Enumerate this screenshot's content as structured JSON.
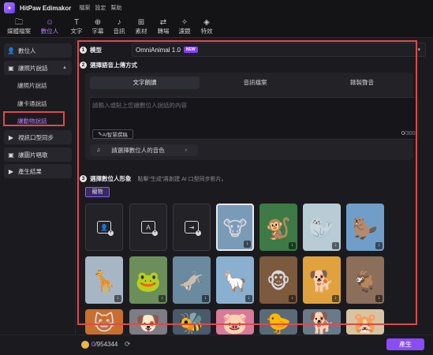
{
  "titlebar": {
    "app_name": "HitPaw Edimakor",
    "menus": [
      "檔案",
      "設定",
      "幫助"
    ]
  },
  "toolbar": {
    "tools": [
      {
        "label": "媒體檔案",
        "icon": "folder-icon"
      },
      {
        "label": "數位人",
        "icon": "digital-human-icon"
      },
      {
        "label": "文字",
        "icon": "text-icon"
      },
      {
        "label": "字幕",
        "icon": "subtitle-icon"
      },
      {
        "label": "音訊",
        "icon": "music-icon"
      },
      {
        "label": "素材",
        "icon": "assets-icon"
      },
      {
        "label": "轉場",
        "icon": "transition-icon"
      },
      {
        "label": "濾鏡",
        "icon": "filter-icon"
      },
      {
        "label": "特效",
        "icon": "effects-icon"
      }
    ],
    "active": "數位人"
  },
  "sidebar": {
    "items": [
      {
        "label": "數位人"
      },
      {
        "label": "讓照片說話"
      },
      {
        "label": "視訊口型同步"
      },
      {
        "label": "讓圖片唱歌"
      },
      {
        "label": "產生結果"
      }
    ],
    "sub_items": [
      "讓照片說話",
      "讓卡通說話",
      "讓動物說話"
    ],
    "selected_sub": "讓動物說話"
  },
  "model": {
    "step": "1",
    "label": "模型",
    "value": "OmniAnimal 1.0",
    "badge": "NEW"
  },
  "upload": {
    "step": "2",
    "label": "選擇語音上傳方式",
    "tabs": [
      "文字朗讀",
      "音訊檔案",
      "錄製聲音"
    ],
    "active_tab": "文字朗讀",
    "placeholder": "請輸入或貼上您讓數位人說話的內容",
    "ai_button": "AI智慧撰稿",
    "counter_current": "0",
    "counter_max": "/300",
    "voice_button": "請選擇數位人的音色"
  },
  "avatar": {
    "step": "3",
    "label": "選擇數位人形象",
    "hint": "點擊“生成”將創建 AI 口型同步影片。",
    "category": "寵物",
    "tiles": [
      {
        "kind": "action",
        "icon": "upload-avatar-icon"
      },
      {
        "kind": "action",
        "icon": "ai-generate-icon"
      },
      {
        "kind": "action",
        "icon": "import-icon"
      },
      {
        "kind": "animal",
        "icon": "highland-cow-icon",
        "glyph": "🐮",
        "bg": "#7a9bb8"
      },
      {
        "kind": "animal",
        "icon": "chimp-icon",
        "glyph": "🐒",
        "bg": "#3d7a45"
      },
      {
        "kind": "animal",
        "icon": "seal-icon",
        "glyph": "🦭",
        "bg": "#b8ccd6"
      },
      {
        "kind": "animal",
        "icon": "capybara-icon",
        "glyph": "🦫",
        "bg": "#6f9fc9"
      },
      {
        "kind": "animal",
        "icon": "giraffe-icon",
        "glyph": "🦒",
        "bg": "#a7b6c4"
      },
      {
        "kind": "animal",
        "icon": "frog-icon",
        "glyph": "🐸",
        "bg": "#6b8e5a"
      },
      {
        "kind": "animal",
        "icon": "donkey-icon",
        "glyph": "🫏",
        "bg": "#6a8aa0"
      },
      {
        "kind": "animal",
        "icon": "llama-icon",
        "glyph": "🦙",
        "bg": "#8ab0cf"
      },
      {
        "kind": "animal",
        "icon": "monkey-icon",
        "glyph": "🐵",
        "bg": "#7c5a3e"
      },
      {
        "kind": "animal",
        "icon": "dog-icon",
        "glyph": "🐕",
        "bg": "#e0a23c"
      },
      {
        "kind": "animal",
        "icon": "goat-icon",
        "glyph": "🐐",
        "bg": "#8b6f5a"
      },
      {
        "kind": "animal",
        "icon": "cat-icon",
        "glyph": "🐱",
        "bg": "#c86f2e"
      },
      {
        "kind": "animal",
        "icon": "dog-icon",
        "glyph": "🐶",
        "bg": "#7d7d85"
      },
      {
        "kind": "animal",
        "icon": "bee-icon",
        "glyph": "🐝",
        "bg": "#4a5a6a"
      },
      {
        "kind": "animal",
        "icon": "pig-icon",
        "glyph": "🐷",
        "bg": "#d87a9a"
      },
      {
        "kind": "animal",
        "icon": "duck-icon",
        "glyph": "🐤",
        "bg": "#5a6a78"
      },
      {
        "kind": "animal",
        "icon": "dog-icon",
        "glyph": "🐕",
        "bg": "#6a7a8a"
      },
      {
        "kind": "animal",
        "icon": "hamster-icon",
        "glyph": "🐹",
        "bg": "#d8c4a0"
      }
    ]
  },
  "footer": {
    "credits_used": "0",
    "credits_total": "/954344",
    "generate_label": "產生"
  }
}
